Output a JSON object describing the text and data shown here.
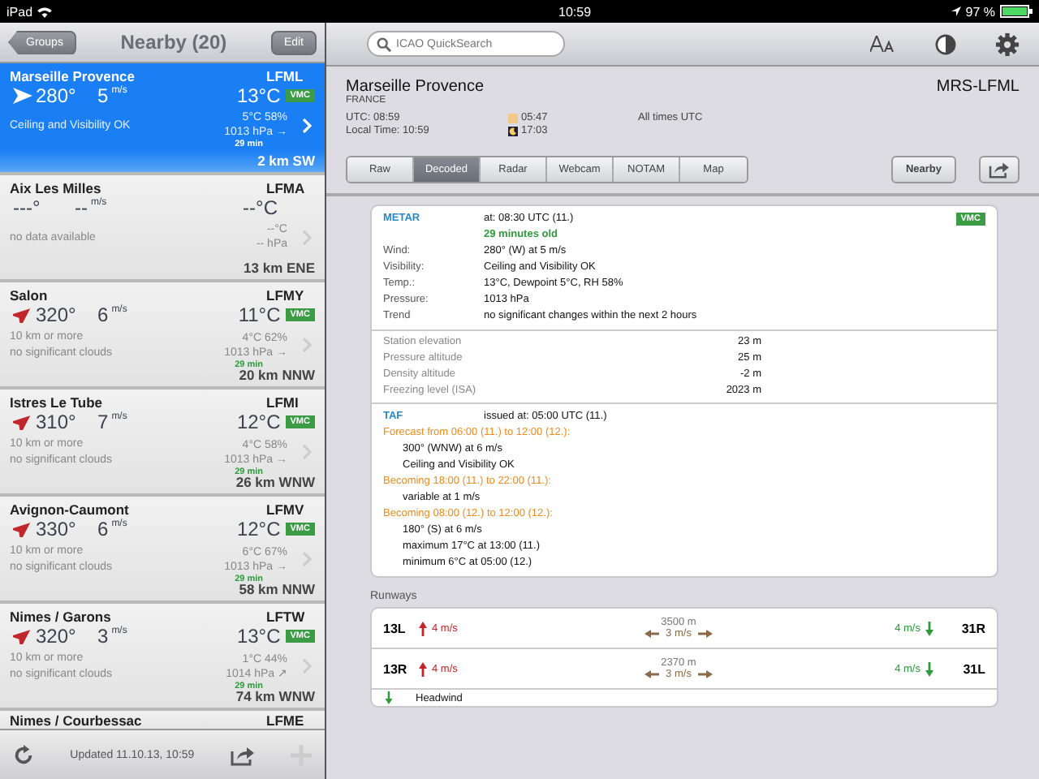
{
  "status_bar": {
    "device": "iPad",
    "time": "10:59",
    "battery": "97 %"
  },
  "sidebar": {
    "back_button": "Groups",
    "title": "Nearby (20)",
    "edit_button": "Edit",
    "stations": [
      {
        "name": "Marseille Provence",
        "code": "LFML",
        "wind_dir": "280°",
        "wind_speed": "5",
        "unit": "m/s",
        "temp": "13°C",
        "vmc": "VMC",
        "dew_rh": "5°C 58%",
        "line_1": "Ceiling and Visibility OK",
        "pressure": "1013 hPa →",
        "age": "29 min",
        "distance": "2 km SW",
        "selected": true
      },
      {
        "name": "Aix Les Milles",
        "code": "LFMA",
        "wind_dir": "---°",
        "wind_speed": "--",
        "unit": "m/s",
        "temp": "--°C",
        "dew_rh": "--°C",
        "line_1": "no data available",
        "pressure": "-- hPa",
        "distance": "13 km ENE",
        "selected": false
      },
      {
        "name": "Salon",
        "code": "LFMY",
        "wind_dir": "320°",
        "wind_speed": "6",
        "unit": "m/s",
        "temp": "11°C",
        "vmc": "VMC",
        "dew_rh": "4°C 62%",
        "line_1": "10 km or more",
        "line_2": "no significant clouds",
        "pressure": "1013 hPa →",
        "age": "29 min",
        "distance": "20 km NNW",
        "selected": false
      },
      {
        "name": "Istres Le Tube",
        "code": "LFMI",
        "wind_dir": "310°",
        "wind_speed": "7",
        "unit": "m/s",
        "temp": "12°C",
        "vmc": "VMC",
        "dew_rh": "4°C 58%",
        "line_1": "10 km or more",
        "line_2": "no significant clouds",
        "pressure": "1013 hPa →",
        "age": "29 min",
        "distance": "26 km WNW",
        "selected": false
      },
      {
        "name": "Avignon-Caumont",
        "code": "LFMV",
        "wind_dir": "330°",
        "wind_speed": "6",
        "unit": "m/s",
        "temp": "12°C",
        "vmc": "VMC",
        "dew_rh": "6°C 67%",
        "line_1": "10 km or more",
        "line_2": "no significant clouds",
        "pressure": "1013 hPa →",
        "age": "29 min",
        "distance": "58 km NNW",
        "selected": false
      },
      {
        "name": "Nimes / Garons",
        "code": "LFTW",
        "wind_dir": "320°",
        "wind_speed": "3",
        "unit": "m/s",
        "temp": "13°C",
        "vmc": "VMC",
        "dew_rh": "1°C 44%",
        "line_1": "10 km or more",
        "line_2": "no significant clouds",
        "pressure": "1014 hPa ↗",
        "age": "29 min",
        "distance": "74 km WNW",
        "selected": false
      }
    ],
    "partial_station": {
      "name": "Nimes / Courbessac",
      "code": "LFME"
    },
    "updated": "Updated 11.10.13, 10:59"
  },
  "search": {
    "placeholder": "ICAO QuickSearch"
  },
  "station": {
    "name": "Marseille Provence",
    "country": "FRANCE",
    "id": "MRS-LFML",
    "utc": "UTC: 08:59",
    "local": "Local Time: 10:59",
    "sunrise": "05:47",
    "sunset": "17:03",
    "note": "All times UTC"
  },
  "tabs": [
    {
      "label": "Raw",
      "selected": false
    },
    {
      "label": "Decoded",
      "selected": true
    },
    {
      "label": "Radar",
      "selected": false
    },
    {
      "label": "Webcam",
      "selected": false
    },
    {
      "label": "NOTAM",
      "selected": false
    },
    {
      "label": "Map",
      "selected": false
    }
  ],
  "nearby_button": "Nearby",
  "metar": {
    "label": "METAR",
    "time": "at: 08:30 UTC (11.)",
    "vmc": "VMC",
    "age": "29 minutes old",
    "rows": [
      {
        "key": "Wind:",
        "value": "280° (W) at 5 m/s"
      },
      {
        "key": "Visibility:",
        "value": "Ceiling and Visibility OK"
      },
      {
        "key": "Temp.:",
        "value": "13°C, Dewpoint 5°C, RH 58%"
      },
      {
        "key": "Pressure:",
        "value": "1013 hPa"
      },
      {
        "key": "Trend",
        "value": "no significant changes within the next 2 hours"
      }
    ],
    "altitudes": [
      {
        "key": "Station elevation",
        "value": "23 m"
      },
      {
        "key": "Pressure altitude",
        "value": "25 m"
      },
      {
        "key": "Density altitude",
        "value": "-2 m"
      },
      {
        "key": "Freezing level (ISA)",
        "value": "2023 m"
      }
    ]
  },
  "taf": {
    "label": "TAF",
    "issued": "issued at: 05:00 UTC (11.)",
    "lines": [
      {
        "kind": "period",
        "text": "Forecast from 06:00 (11.) to 12:00 (12.):"
      },
      {
        "kind": "detail",
        "text": "300° (WNW) at 6 m/s"
      },
      {
        "kind": "detail",
        "text": "Ceiling and Visibility OK"
      },
      {
        "kind": "period",
        "text": "Becoming 18:00 (11.) to 22:00 (11.):"
      },
      {
        "kind": "detail",
        "text": "variable at 1 m/s"
      },
      {
        "kind": "period",
        "text": "Becoming 08:00 (12.) to 12:00 (12.):"
      },
      {
        "kind": "detail",
        "text": "180° (S) at 6 m/s"
      },
      {
        "kind": "detail",
        "text": "maximum 17°C at 13:00 (11.)"
      },
      {
        "kind": "detail",
        "text": "minimum 6°C at 05:00 (12.)"
      }
    ]
  },
  "runways": {
    "title": "Runways",
    "rows": [
      {
        "left": "13L",
        "left_wind": "4 m/s",
        "length": "3500 m",
        "cross": "3 m/s",
        "right_wind": "4 m/s",
        "right": "31R"
      },
      {
        "left": "13R",
        "left_wind": "4 m/s",
        "length": "2370 m",
        "cross": "3 m/s",
        "right_wind": "4 m/s",
        "right": "31L"
      }
    ],
    "legend": "Headwind"
  }
}
